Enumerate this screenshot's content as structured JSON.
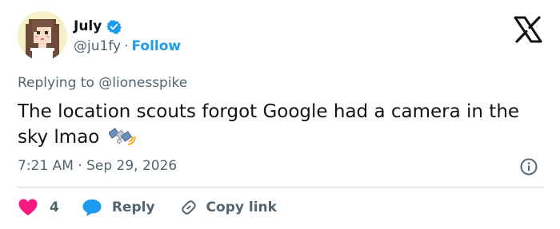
{
  "author": {
    "display_name": "July",
    "handle": "@ju1fy",
    "separator": "·",
    "follow_label": "Follow",
    "avatar_icon": "pixel-art-girl-avatar",
    "verified_color": "#1d9bf0"
  },
  "tweet": {
    "replying_to_prefix": "Replying to ",
    "replying_to_user": "@lionesspike",
    "text": "The location scouts forgot Google had a camera in the sky lmao",
    "emoji_icon": "satellite-icon",
    "timestamp": "7:21 AM · Sep 29, 2026"
  },
  "actions": {
    "like_count": "4",
    "reply_label": "Reply",
    "copy_link_label": "Copy link"
  },
  "colors": {
    "text_primary": "#0f1419",
    "text_secondary": "#536471",
    "accent_blue": "#1d9bf0",
    "like_red": "#f91880",
    "divider": "#cfd9de"
  }
}
